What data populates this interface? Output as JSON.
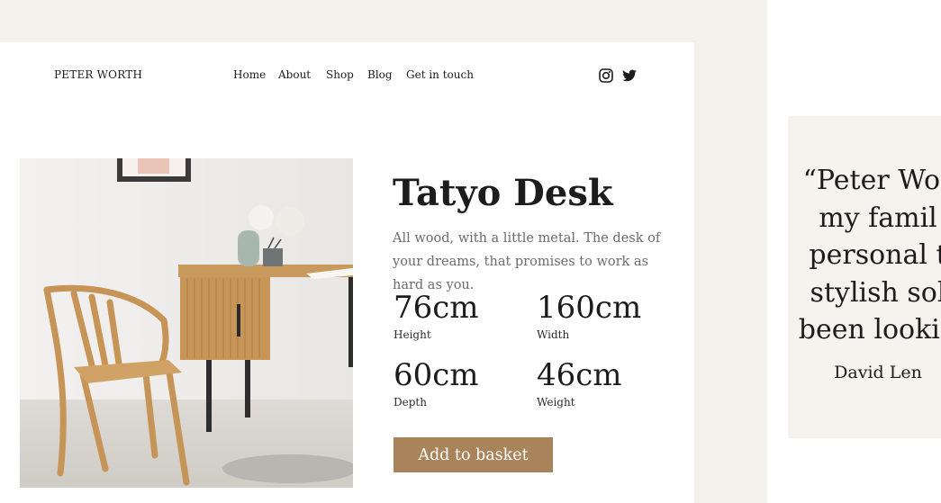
{
  "header": {
    "brand": "PETER WORTH",
    "nav": [
      "Home",
      "About",
      "Shop",
      "Blog",
      "Get in touch"
    ],
    "social_icons": [
      "instagram-icon",
      "twitter-icon"
    ]
  },
  "product": {
    "name": "Tatyo Desk",
    "description": "All wood, with a little metal. The desk of your dreams, that promises to work as hard as you.",
    "specs": [
      {
        "value": "76cm",
        "label": "Height"
      },
      {
        "value": "160cm",
        "label": "Width"
      },
      {
        "value": "60cm",
        "label": "Depth"
      },
      {
        "value": "46cm",
        "label": "Weight"
      }
    ],
    "cta_label": "Add to basket"
  },
  "testimonial": {
    "lines": [
      "“Peter Wor",
      "my famil",
      "personal t",
      "stylish sol",
      "been lookin"
    ],
    "author": "David Len"
  },
  "colors": {
    "page_background": "#f4f0eb",
    "card_background": "#ffffff",
    "accent": "#a98359",
    "quote_card": "#f6f2ee"
  }
}
